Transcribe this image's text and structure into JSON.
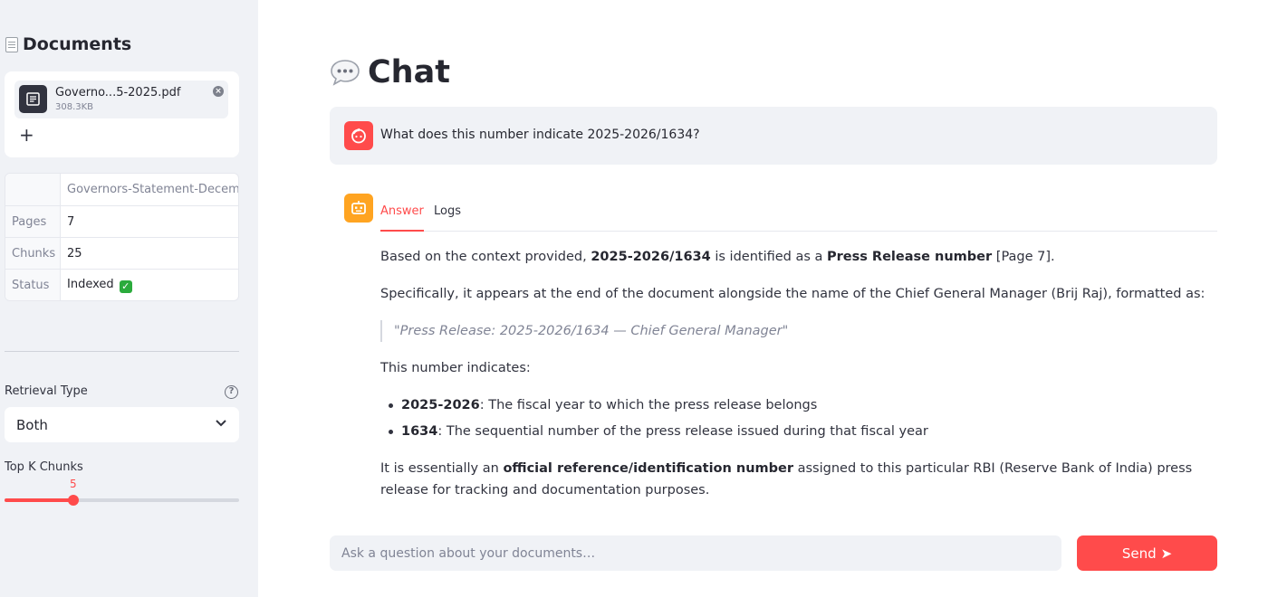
{
  "sidebar": {
    "title": "Documents",
    "file": {
      "name": "Governo...5-2025.pdf",
      "size": "308.3KB"
    },
    "add_label": "+",
    "table": {
      "header": "Governors-Statement-December",
      "rows": [
        {
          "key": "Pages",
          "value": "7"
        },
        {
          "key": "Chunks",
          "value": "25"
        },
        {
          "key": "Status",
          "value": "Indexed"
        }
      ]
    },
    "retrieval_type": {
      "label": "Retrieval Type",
      "value": "Both"
    },
    "top_k": {
      "label": "Top K Chunks",
      "value": "5",
      "fraction": 0.295
    }
  },
  "main": {
    "title": "Chat",
    "user_message": "What does this number indicate 2025-2026/1634?",
    "tabs": [
      {
        "label": "Answer"
      },
      {
        "label": "Logs"
      }
    ],
    "answer": {
      "p1": {
        "pre": "Based on the context provided, ",
        "b1": "2025-2026/1634",
        "mid": " is identified as a ",
        "b2": "Press Release number",
        "post": " [Page 7]."
      },
      "p2": "Specifically, it appears at the end of the document alongside the name of the Chief General Manager (Brij Raj), formatted as:",
      "quote": "\"Press Release: 2025-2026/1634 — Chief General Manager\"",
      "p3": "This number indicates:",
      "bullets": [
        {
          "b": "2025-2026",
          "text": ": The fiscal year to which the press release belongs"
        },
        {
          "b": "1634",
          "text": ": The sequential number of the press release issued during that fiscal year"
        }
      ],
      "p4": {
        "pre": "It is essentially an ",
        "b": "official reference/identification number",
        "post": " assigned to this particular RBI (Reserve Bank of India) press release for tracking and documentation purposes."
      }
    },
    "input": {
      "placeholder": "Ask a question about your documents…"
    },
    "send": {
      "label": "Send",
      "arrow": "➤"
    }
  },
  "colors": {
    "accent": "#ff4b4b",
    "bot_avatar": "#ffa421",
    "status_ok": "#2bab3c"
  },
  "icons": [
    "page-icon",
    "file-icon",
    "close-icon",
    "plus-icon",
    "help-icon",
    "chevron-down-icon",
    "speech-bubble-icon",
    "user-avatar-icon",
    "bot-avatar-icon",
    "checkmark-icon"
  ]
}
